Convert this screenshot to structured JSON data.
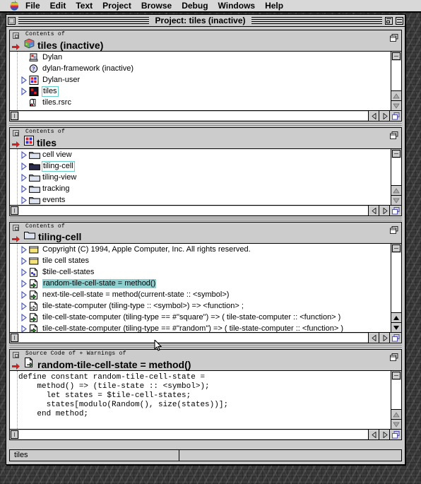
{
  "menubar": {
    "apple_icon": "apple-logo-icon",
    "items": [
      "File",
      "Edit",
      "Text",
      "Project",
      "Browse",
      "Debug",
      "Windows",
      "Help"
    ]
  },
  "window": {
    "title": "Project: tiles (inactive)",
    "close_box": "close-box-icon",
    "zoom_box": "zoom-box-icon",
    "collapse_box": "collapse-box-icon"
  },
  "panes": [
    {
      "label": "Contents of",
      "title": "tiles (inactive)",
      "title_icon": "dylan-cube-icon",
      "stack_icon": "window-stack-icon",
      "marker_icon": "red-right-arrow-icon",
      "rows": [
        {
          "triangle": false,
          "icon": "dylan-library-icon",
          "text": "Dylan",
          "state": "normal"
        },
        {
          "triangle": false,
          "icon": "dylan-question-icon",
          "text": "dylan-framework (inactive)",
          "state": "normal"
        },
        {
          "triangle": true,
          "icon": "module-red-icon",
          "text": "Dylan-user",
          "state": "normal"
        },
        {
          "triangle": true,
          "icon": "module-dark-red-icon",
          "text": "tiles",
          "state": "outlined"
        },
        {
          "triangle": false,
          "icon": "resource-file-icon",
          "text": "tiles.rsrc",
          "state": "normal"
        }
      ]
    },
    {
      "label": "Contents of",
      "title": "tiles",
      "title_icon": "module-red-icon",
      "stack_icon": "window-stack-icon",
      "marker_icon": "red-right-arrow-icon",
      "rows": [
        {
          "triangle": true,
          "icon": "folder-light-icon",
          "text": "cell view",
          "state": "normal"
        },
        {
          "triangle": true,
          "icon": "folder-dark-icon",
          "text": "tiling-cell",
          "state": "outlined"
        },
        {
          "triangle": true,
          "icon": "folder-light-icon",
          "text": "tiling-view",
          "state": "normal"
        },
        {
          "triangle": true,
          "icon": "folder-light-icon",
          "text": "tracking",
          "state": "normal"
        },
        {
          "triangle": true,
          "icon": "folder-light-icon",
          "text": "events",
          "state": "normal"
        }
      ]
    },
    {
      "label": "Contents of",
      "title": "tiling-cell",
      "title_icon": "folder-light-icon",
      "stack_icon": "window-stack-icon",
      "marker_icon": "red-right-arrow-icon",
      "rows": [
        {
          "triangle": true,
          "icon": "comment-note-icon",
          "text": "Copyright (C) 1994, Apple Computer, Inc. All rights reserved.",
          "state": "normal"
        },
        {
          "triangle": true,
          "icon": "comment-note-icon",
          "text": "tile cell states",
          "state": "normal"
        },
        {
          "triangle": true,
          "icon": "constant-var-icon",
          "text": "$tile-cell-states",
          "state": "normal"
        },
        {
          "triangle": true,
          "icon": "method-green-icon",
          "text": "random-tile-cell-state = method()",
          "state": "selected"
        },
        {
          "triangle": true,
          "icon": "method-green-icon",
          "text": "next-tile-cell-state = method(current-state :: <symbol>)",
          "state": "normal"
        },
        {
          "triangle": true,
          "icon": "generic-white-icon",
          "text": "tile-state-computer (tiling-type :: <symbol>) => <function> ;",
          "state": "normal"
        },
        {
          "triangle": true,
          "icon": "method-green-icon",
          "text": "tile-cell-state-computer (tiling-type == #\"square\") => ( tile-state-computer :: <function> )",
          "state": "normal"
        },
        {
          "triangle": true,
          "icon": "method-green-icon",
          "text": "tile-cell-state-computer (tiling-type == #\"random\") => ( tile-state-computer :: <function> )",
          "state": "normal"
        }
      ]
    }
  ],
  "source_pane": {
    "label": "Source Code of + Warnings of",
    "title": "random-tile-cell-state = method()",
    "title_icon": "method-green-icon",
    "stack_icon": "window-stack-icon",
    "marker_icon": "red-right-arrow-icon",
    "code": "define constant random-tile-cell-state =\n    method() => (tile-state :: <symbol>);\n      let states = $tile-cell-states;\n      states[modulo(Random(), size(states))];\n    end method;"
  },
  "statusbar": {
    "text": "tiles"
  },
  "scrollbars": {
    "up_arrow_icon": "scroll-up-arrow-icon",
    "down_arrow_icon": "scroll-down-arrow-icon",
    "left_arrow_icon": "scroll-left-arrow-icon",
    "right_arrow_icon": "scroll-right-arrow-icon",
    "grow_icon": "grow-box-icon"
  },
  "cursor": {
    "icon": "mouse-pointer-icon"
  },
  "colors": {
    "desktop": "#3a3a3a",
    "chrome": "#cccccc",
    "selection": "#8fd1d1",
    "outline": "#66cccc",
    "marker": "#cc2222"
  }
}
